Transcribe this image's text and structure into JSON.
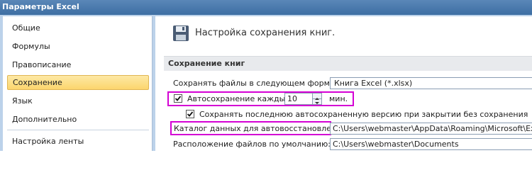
{
  "window": {
    "title": "Параметры Excel"
  },
  "sidebar": {
    "items": [
      {
        "label": "Общие"
      },
      {
        "label": "Формулы"
      },
      {
        "label": "Правописание"
      },
      {
        "label": "Сохранение"
      },
      {
        "label": "Язык"
      },
      {
        "label": "Дополнительно"
      },
      {
        "label": "Настройка ленты"
      }
    ],
    "selected": "Сохранение"
  },
  "main": {
    "header_icon": "floppy-disk-icon",
    "title": "Настройка сохранения книг.",
    "section_title": "Сохранение книг",
    "format": {
      "label": "Сохранять файлы в следующем формате:",
      "value": "Книга Excel (*.xlsx)"
    },
    "autosave": {
      "label": "Автосохранение каждые",
      "checked": true,
      "minutes": "10",
      "unit": "мин."
    },
    "keep_last": {
      "label": "Сохранять последнюю автосохраненную версию при закрытии без сохранения",
      "checked": true
    },
    "autorecover": {
      "label": "Каталог данных для автовосстановления:",
      "value": "C:\\Users\\webmaster\\AppData\\Roaming\\Microsoft\\Excel\\"
    },
    "default_location": {
      "label": "Расположение файлов по умолчанию:",
      "value": "C:\\Users\\webmaster\\Documents"
    }
  },
  "colors": {
    "highlight": "#d400d4",
    "selected_nav": "#fcd56d",
    "title_bar": "#3d6ea3"
  }
}
